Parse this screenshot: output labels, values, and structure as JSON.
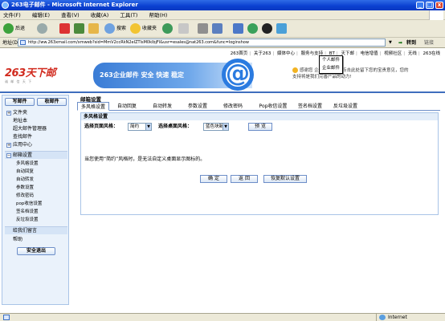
{
  "window": {
    "title": "263电子邮件 - Microsoft Internet Explorer"
  },
  "menu": [
    "文件(F)",
    "编辑(E)",
    "查看(V)",
    "收藏(A)",
    "工具(T)",
    "帮助(H)"
  ],
  "toolbar": {
    "back": "后退",
    "search": "搜索",
    "favorites": "收藏夹"
  },
  "address": {
    "label": "地址(D)",
    "url": "http://ww.263xmail.com/xmweb?sid=MmV2ccRkN2eIZTlsM0klbjFl&usr=esales@nat263.com&func=loginshow",
    "go": "转到",
    "links": "链接"
  },
  "toplinks": [
    "263首页",
    "关于263",
    "媒体中心",
    "服务与支持",
    "BT",
    "天下邮",
    "电信增值",
    "视频社区",
    "无线",
    "263在线"
  ],
  "logo": {
    "text": "263天下邮",
    "tagline": "诚 邮 信 天 下"
  },
  "banner": {
    "text": "263企业邮件 安全 快速 稳定"
  },
  "notice": {
    "line1": "感谢您 企业邮件 邮，点击此处留下您的宝贵意见，您的",
    "line2": "支持将是我们完善产品的动力!"
  },
  "tooltip": {
    "line1": "个人邮件",
    "line2": "企业邮件"
  },
  "sidebar": {
    "write": "写邮件",
    "receive": "收邮件",
    "items": [
      "文件夹",
      "地址本",
      "超大邮件管理器",
      "查找邮件",
      "应用中心",
      "邮箱设置"
    ],
    "sub": [
      "多风格设置",
      "自动回复",
      "自动转发",
      "参数设置",
      "修改密码",
      "pop收信设置",
      "签名档设置",
      "反垃圾设置"
    ],
    "bottom": [
      "给我们留言",
      "帮助"
    ],
    "logout": "安全退出"
  },
  "main": {
    "title": "邮箱设置",
    "tabs": [
      "多风格设置",
      "自动回复",
      "自动转发",
      "参数设置",
      "修改密码",
      "Pop收信设置",
      "签名档设置",
      "反垃圾设置"
    ],
    "panel_title": "多风格设置",
    "page_style_label": "选择页面风格：",
    "page_style_value": "简约",
    "desktop_style_label": "选择桌面风格：",
    "desktop_style_value": "蓝色块新",
    "preview": "预 览",
    "description": "当您使用“简约”风格时，是无法自定义桌面显示图标的。",
    "ok": "确 定",
    "back": "返 回",
    "reset": "恢复默认设置"
  },
  "status": {
    "zone": "Internet"
  }
}
